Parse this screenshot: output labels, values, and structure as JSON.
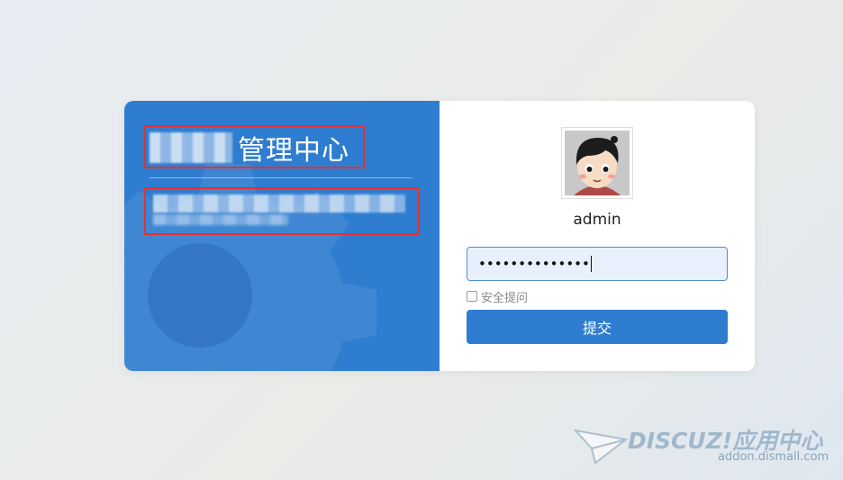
{
  "login": {
    "title_suffix": "管理中心",
    "username": "admin",
    "password_value": "••••••••••••••",
    "security_question_label": "安全提问",
    "submit_label": "提交"
  },
  "watermark": {
    "brand": "DISCUZ!应用中心",
    "url": "addon.dismall.com"
  },
  "colors": {
    "panel_blue": "#2f7dd0",
    "highlight_red": "#e53030",
    "input_bg": "#e8f0fe"
  }
}
